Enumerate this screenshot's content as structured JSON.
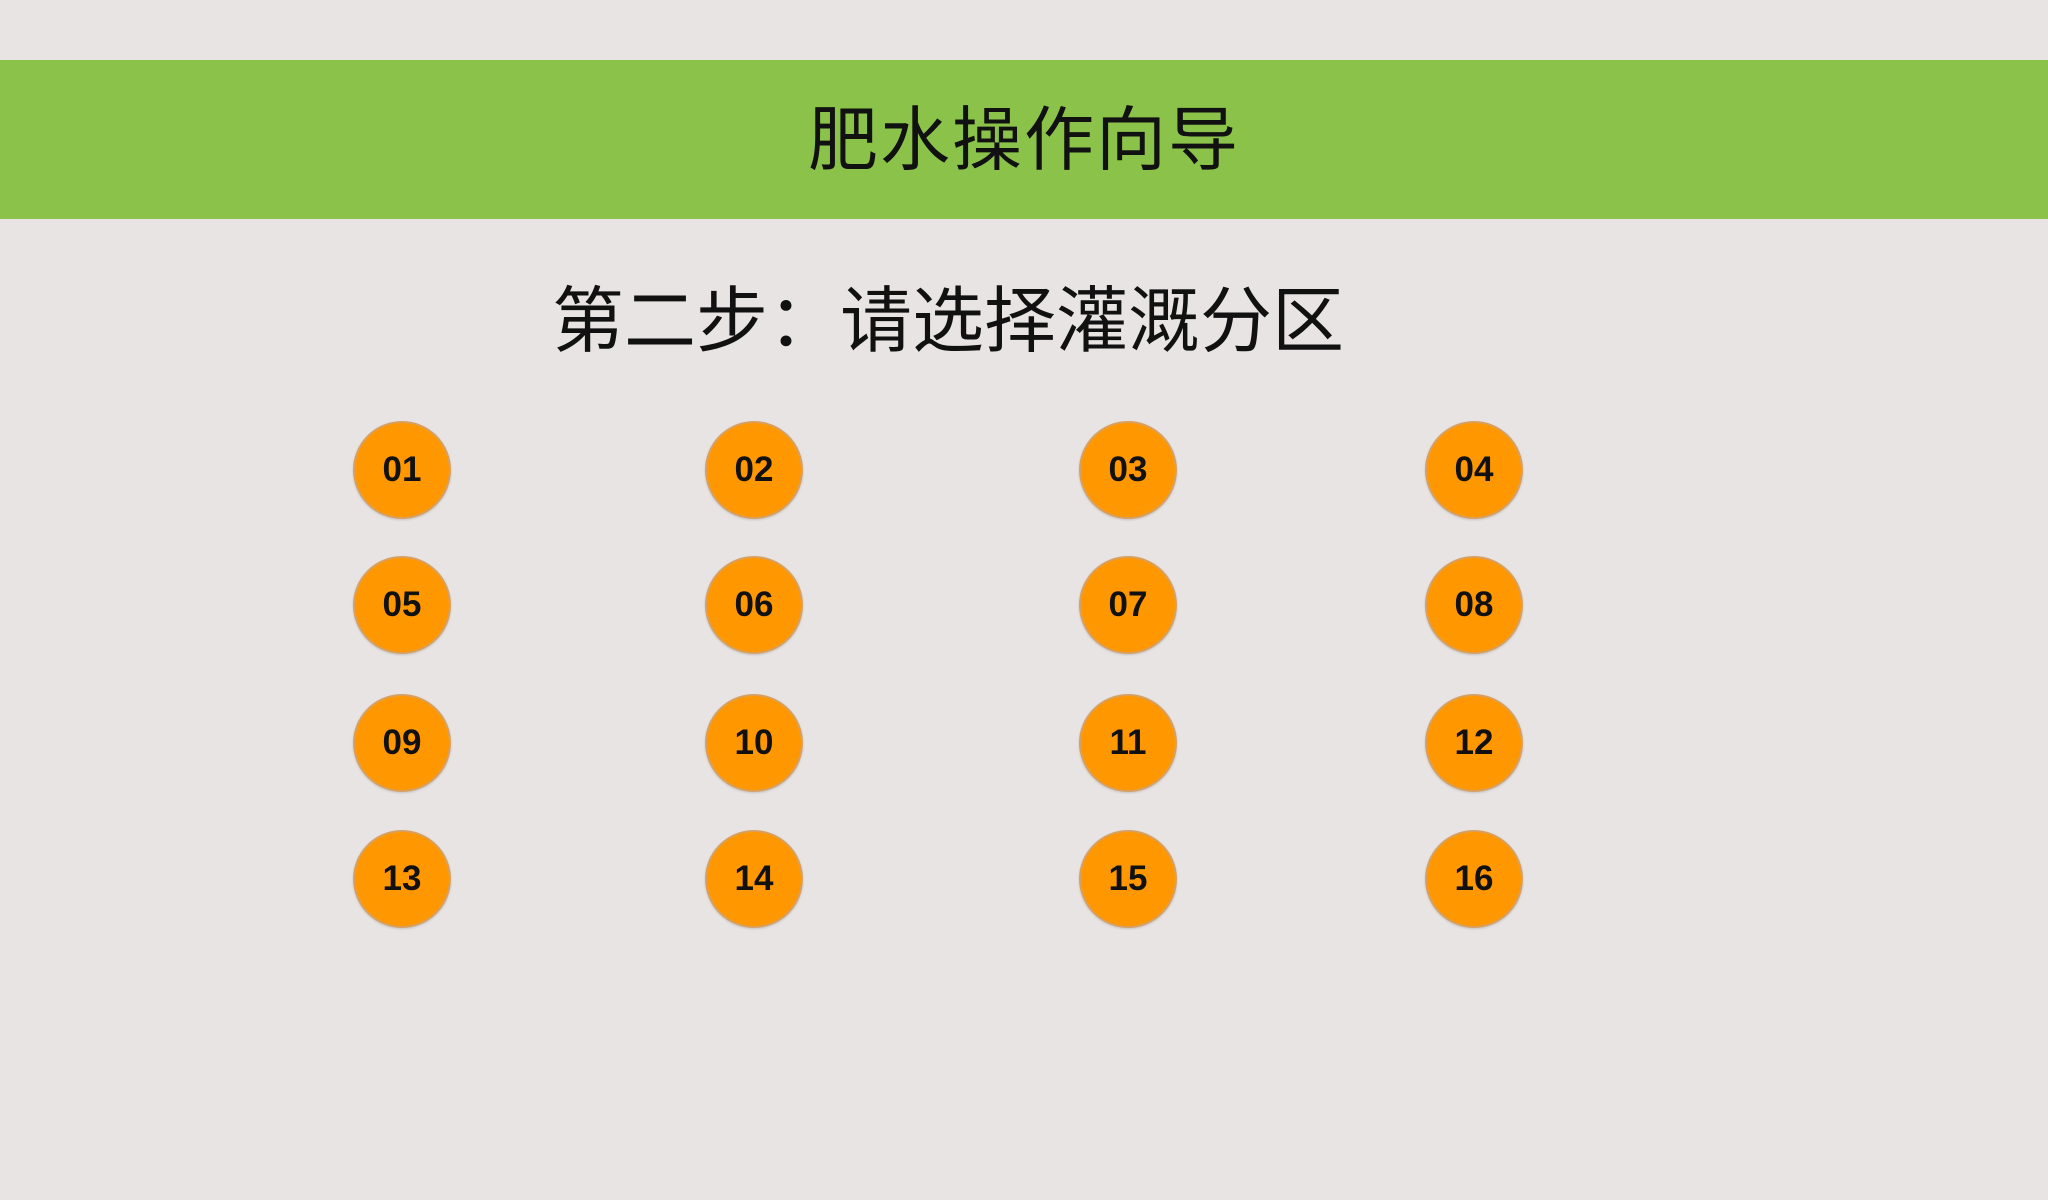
{
  "header": {
    "title": "肥水操作向导"
  },
  "step": {
    "heading": "第二步：请选择灌溉分区"
  },
  "zones": [
    "01",
    "02",
    "03",
    "04",
    "05",
    "06",
    "07",
    "08",
    "09",
    "10",
    "11",
    "12",
    "13",
    "14",
    "15",
    "16"
  ],
  "colors": {
    "header_bg": "#8bc34a",
    "page_bg": "#e8e4e3",
    "zone_button": "#ff9800"
  }
}
